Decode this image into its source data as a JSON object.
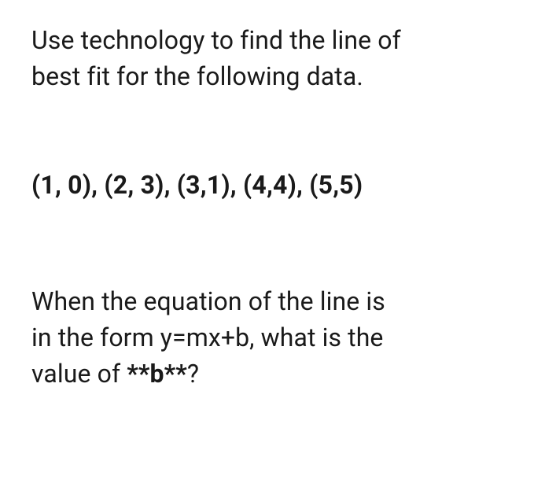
{
  "intro": {
    "line1": "Use technology to find the line of",
    "line2": "best fit for the following data."
  },
  "dataPoints": "(1, 0), (2, 3), (3,1), (4,4), (5,5)",
  "question": {
    "line1": "When the equation of the line is",
    "line2_part1": "in the form y=mx+b, what is the",
    "line3_part1": "value of ",
    "line3_bold": "**b**",
    "line3_part2": "?"
  }
}
